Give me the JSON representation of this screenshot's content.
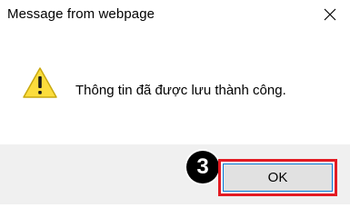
{
  "dialog": {
    "title": "Message from webpage",
    "message": "Thông tin đã được lưu thành công.",
    "icon": "warning-icon",
    "ok_label": "OK",
    "step_badge": "3",
    "colors": {
      "highlight_border": "#e31b23",
      "button_focus_border": "#0078d7",
      "warning_fill": "#fcdd3d",
      "footer_background": "#f0f0f0"
    }
  }
}
